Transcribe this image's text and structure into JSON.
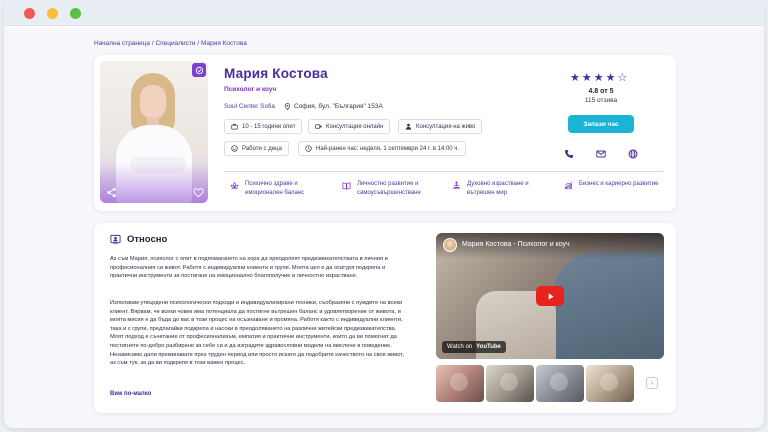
{
  "breadcrumb": {
    "items": [
      "Начална страница",
      "Специалисти",
      "Мария Костова"
    ],
    "separator": "/"
  },
  "profile": {
    "name": "Мария Костова",
    "title": "Психолог и коуч",
    "center": "Soul Center Sofia",
    "address": "София, бул. \"България\" 153А",
    "verified": true
  },
  "chips": {
    "experience": "10 - 15 години опит",
    "online": "Консултация онлайн",
    "in_person": "Консултация на живо",
    "children": "Работи с деца",
    "earliest": "Най-ранен час: неделя, 1 септември 24 г. в 14:00 ч."
  },
  "rating": {
    "stars_filled": 4,
    "stars_total": 5,
    "value_text": "4.8 от 5",
    "reviews_text": "115 отзива"
  },
  "book_button": "Запази час",
  "contact_icons": [
    "phone-icon",
    "mail-icon",
    "globe-icon"
  ],
  "categories": [
    {
      "icon": "lotus-icon",
      "label": "Психично здраве и емоционален баланс"
    },
    {
      "icon": "book-icon",
      "label": "Личностно развитие и самоусъвършенстване"
    },
    {
      "icon": "meditation-icon",
      "label": "Духовно израстване и вътрешен мир"
    },
    {
      "icon": "chart-icon",
      "label": "Бизнес и кариерно развитие"
    }
  ],
  "about": {
    "title": "Относно",
    "paragraph1": "Аз съм Мария, психолог с опит в подпомагането на хора да преодолеят предизвикателствата в личния и професионалния си живот. Работя с индивидуални клиенти и групи. Моята цел е да осигуря подкрепа и практични инструменти за постигане на емоционално благополучие и личностно израстване.",
    "paragraph2": "Използвам утвърдени психологически подходи и индивидуализирани техники, съобразени с нуждите на всеки клиент. Вярвам, че всеки човек има потенциала да постигне вътрешен баланс и удовлетворение от живота, и моята мисия е да бъда до вас в този процес на осъзнаване и промяна. Работя както с индивидуални клиенти, така и с групи, предлагайки подкрепа и насоки в преодоляването на различни житейски предизвикателства. Моят подход е съчетание от професионализъм, емпатия и практични инструменти, които да ви помогнат да постигнете по-добро разбиране за себе си и да изградите здравословни модели на мислене и поведение. Независимо дали преминавате през труден период или просто искате да подобрите качеството на своя живот, аз съм тук, за да ви подкрепя в този важен процес.",
    "see_less": "Виж по-малко"
  },
  "video": {
    "title": "Мария Костова - Психолог и коуч",
    "watch_on": "Watch on",
    "platform": "YouTube"
  },
  "gallery": {
    "count": 4,
    "next_label": "›"
  }
}
